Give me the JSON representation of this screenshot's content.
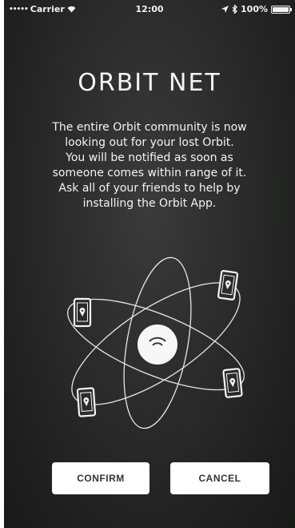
{
  "status_bar": {
    "signal": "•••••",
    "carrier": "Carrier",
    "wifi_icon": "wifi-icon",
    "time": "12:00",
    "location_icon": "location-arrow-icon",
    "bluetooth_icon": "bluetooth-icon",
    "battery_text": "100%",
    "battery_level": 1.0
  },
  "screen": {
    "title": "ORBIT NET",
    "message_lines": [
      "The entire Orbit community is now",
      "looking out for your lost Orbit.",
      "You will be notified as soon as",
      "someone comes within range of it.",
      "Ask all of your friends to help by",
      "installing the Orbit App."
    ]
  },
  "illustration": {
    "center_icon": "orbit-device-icon",
    "phone_icon": "phone-location-icon"
  },
  "actions": {
    "confirm_label": "CONFIRM",
    "cancel_label": "CANCEL"
  },
  "colors": {
    "background": "#2a2b2a",
    "foreground": "#f4f4f4",
    "button_bg": "#ffffff",
    "button_text": "#333333"
  }
}
